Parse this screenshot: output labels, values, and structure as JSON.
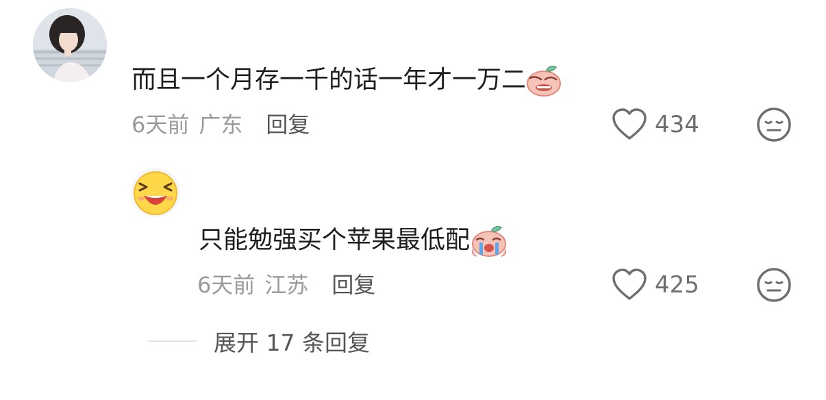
{
  "comments": [
    {
      "avatar": "user-photo-avatar",
      "text": "而且一个月存一千的话一年才一万二",
      "emoji": "peach-crying-emoji",
      "time": "6天前",
      "location": "广东",
      "reply_label": "回复",
      "likes": "434",
      "like_icon": "heart-outline-icon",
      "dislike_icon": "neutral-face-icon"
    },
    {
      "avatar": "laughing-emoji-avatar",
      "text": "只能勉强买个苹果最低配",
      "emoji": "peach-sobbing-emoji",
      "time": "6天前",
      "location": "江苏",
      "reply_label": "回复",
      "likes": "425",
      "like_icon": "heart-outline-icon",
      "dislike_icon": "neutral-face-icon"
    }
  ],
  "expand_replies": {
    "label": "展开 17 条回复"
  },
  "colors": {
    "text_primary": "#1e1e1e",
    "text_secondary": "#9a9a9a",
    "action_text": "#555555",
    "icon_gray": "#6e6e6e",
    "divider": "#e3e3e3"
  }
}
